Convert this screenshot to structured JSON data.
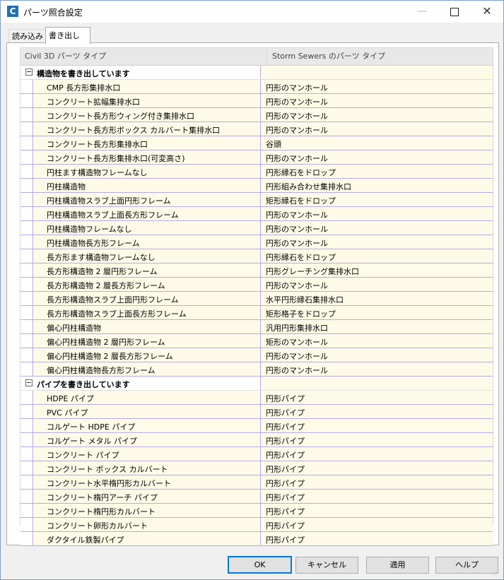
{
  "window": {
    "title": "パーツ照合設定",
    "app_icon_letter": "C",
    "minimize_glyph": "—",
    "close_glyph": "✕"
  },
  "tabs": {
    "read": "読み込み",
    "write": "書き出し"
  },
  "grid": {
    "col1_header": "Civil 3D パーツ タイプ",
    "col2_header": "Storm Sewers のパーツ タイプ",
    "groups": [
      {
        "label": "構造物を書き出しています",
        "rows": [
          {
            "name": "CMP 長方形集排水口",
            "value": "円形のマンホール"
          },
          {
            "name": "コンクリート拡幅集排水口",
            "value": "円形のマンホール"
          },
          {
            "name": "コンクリート長方形ウィング付き集排水口",
            "value": "円形のマンホール"
          },
          {
            "name": "コンクリート長方形ボックス カルバート集排水口",
            "value": "円形のマンホール"
          },
          {
            "name": "コンクリート長方形集排水口",
            "value": "谷頭"
          },
          {
            "name": "コンクリート長方形集排水口(可変高さ)",
            "value": "円形のマンホール"
          },
          {
            "name": "円柱ます構造物フレームなし",
            "value": "円形縁石をドロップ"
          },
          {
            "name": "円柱構造物",
            "value": "円形組み合わせ集排水口"
          },
          {
            "name": "円柱構造物スラブ上面円形フレーム",
            "value": "矩形縁石をドロップ"
          },
          {
            "name": "円柱構造物スラブ上面長方形フレーム",
            "value": "円形のマンホール"
          },
          {
            "name": "円柱構造物フレームなし",
            "value": "円形のマンホール"
          },
          {
            "name": "円柱構造物長方形フレーム",
            "value": "円形のマンホール"
          },
          {
            "name": "長方形ます構造物フレームなし",
            "value": "円形縁石をドロップ"
          },
          {
            "name": "長方形構造物 2 層円形フレーム",
            "value": "円形グレーチング集排水口"
          },
          {
            "name": "長方形構造物 2 層長方形フレーム",
            "value": "円形のマンホール"
          },
          {
            "name": "長方形構造物スラブ上面円形フレーム",
            "value": "水平円形縁石集排水口"
          },
          {
            "name": "長方形構造物スラブ上面長方形フレーム",
            "value": "矩形格子をドロップ"
          },
          {
            "name": "偏心円柱構造物",
            "value": "汎用円形集排水口"
          },
          {
            "name": "偏心円柱構造物 2 層円形フレーム",
            "value": "矩形のマンホール"
          },
          {
            "name": "偏心円柱構造物 2 層長方形フレーム",
            "value": "円形のマンホール"
          },
          {
            "name": "偏心円柱構造物長方形フレーム",
            "value": "円形のマンホール"
          }
        ]
      },
      {
        "label": "パイプを書き出しています",
        "rows": [
          {
            "name": "HDPE パイプ",
            "value": "円形パイプ"
          },
          {
            "name": "PVC パイプ",
            "value": "円形パイプ"
          },
          {
            "name": "コルゲート HDPE パイプ",
            "value": "円形パイプ"
          },
          {
            "name": "コルゲート メタル パイプ",
            "value": "円形パイプ"
          },
          {
            "name": "コンクリート パイプ",
            "value": "円形パイプ"
          },
          {
            "name": "コンクリート ボックス カルバート",
            "value": "円形パイプ"
          },
          {
            "name": "コンクリート水平楕円形カルバート",
            "value": "円形パイプ"
          },
          {
            "name": "コンクリート楕円アーチ パイプ",
            "value": "円形パイプ"
          },
          {
            "name": "コンクリート楕円形カルバート",
            "value": "円形パイプ"
          },
          {
            "name": "コンクリート卵形カルバート",
            "value": "円形パイプ"
          },
          {
            "name": "ダクタイル鉄製パイプ",
            "value": "円形パイプ"
          }
        ]
      }
    ]
  },
  "buttons": {
    "ok": "OK",
    "cancel": "キャンセル",
    "apply": "適用",
    "help": "ヘルプ"
  }
}
